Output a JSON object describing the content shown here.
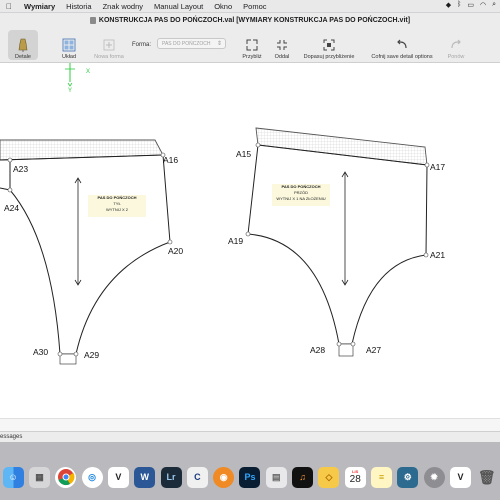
{
  "menubar": {
    "items": [
      "Wymiary",
      "Historia",
      "Znak wodny",
      "Manual Layout",
      "Okno",
      "Pomoc"
    ]
  },
  "window": {
    "title": "KONSTRUKCJA PAS DO POŃCZOCH.val [WYMIARY KONSTRUKCJA PAS DO POŃCZOCH.vit]"
  },
  "toolbar": {
    "detale": "Detale",
    "uklad": "Układ",
    "nowa_forma": "Nowa forma",
    "forma_label": "Forma:",
    "forma_value": "PAS DO POŃCZOCH",
    "przybliz": "Przybliż",
    "oddal": "Oddal",
    "dopasuj": "Dopasuj przybliżenie",
    "cofnij": "Cofnij save detail options",
    "ponow": "Ponów"
  },
  "canvas": {
    "axis_x": "X",
    "axis_y": "Y",
    "left_piece": {
      "title": "PAS DO POŃCZOCH",
      "line2": "TYŁ",
      "line3": "WYTNIJ X 2",
      "points": [
        "A23",
        "A16",
        "A24",
        "A20",
        "A30",
        "A29"
      ]
    },
    "right_piece": {
      "title": "PAS DO POŃCZOCH",
      "line2": "PRZÓD",
      "line3": "WYTNIJ X 1 NA ZŁOŻENIU",
      "points": [
        "A15",
        "A17",
        "A19",
        "A21",
        "A28",
        "A27"
      ]
    }
  },
  "messages": {
    "label": "essages"
  },
  "dock": {
    "calendar_month": "LIS",
    "calendar_day": "28",
    "apps": [
      "finder-icon",
      "launchpad-icon",
      "chrome-icon",
      "safari-icon",
      "valentina-icon",
      "word-icon",
      "lightroom-icon",
      "clo-icon",
      "blender-icon",
      "photoshop-icon",
      "preview-icon",
      "music-icon",
      "sketch-icon",
      "calendar-icon",
      "notes-icon",
      "app-icon",
      "settings-icon",
      "valentina-2-icon",
      "trash-icon"
    ]
  }
}
